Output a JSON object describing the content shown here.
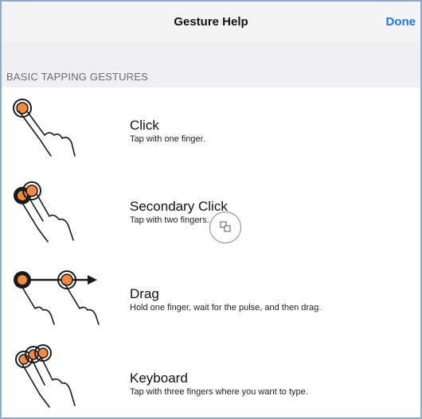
{
  "navbar": {
    "title": "Gesture Help",
    "done_label": "Done"
  },
  "section": {
    "title": "BASIC TAPPING GESTURES"
  },
  "gestures": [
    {
      "title": "Click",
      "desc": "Tap with one finger."
    },
    {
      "title": "Secondary Click",
      "desc": "Tap with two fingers."
    },
    {
      "title": "Drag",
      "desc": "Hold one finger, wait for the pulse, and then drag."
    },
    {
      "title": "Keyboard",
      "desc": "Tap with three fingers where you want to type."
    }
  ],
  "colors": {
    "accent": "#1a7ae8",
    "tap_fill": "#f08a3c",
    "tap_dark": "#1a1a1a"
  },
  "icons": [
    "one-finger-tap-icon",
    "two-finger-tap-icon",
    "drag-gesture-icon",
    "three-finger-tap-icon",
    "pointer-cursor-icon"
  ]
}
